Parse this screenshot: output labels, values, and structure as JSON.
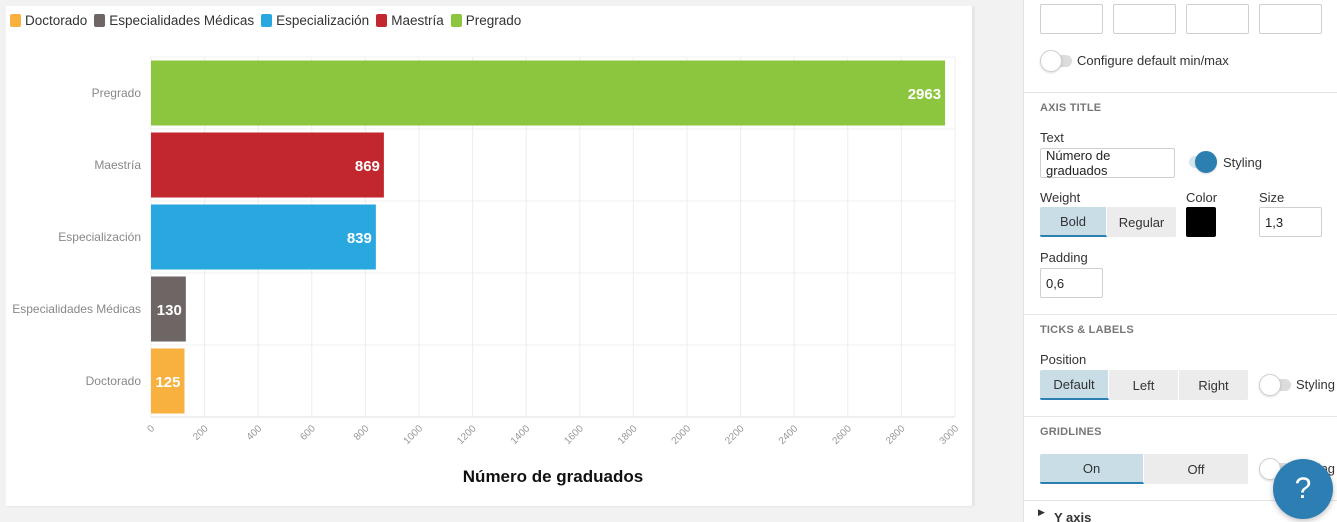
{
  "chart_data": {
    "type": "bar",
    "orientation": "horizontal",
    "categories": [
      "Pregrado",
      "Maestría",
      "Especialización",
      "Especialidades Médicas",
      "Doctorado"
    ],
    "values": [
      2963,
      869,
      839,
      130,
      125
    ],
    "colors": [
      "#8cc63f",
      "#c1272d",
      "#29a8e0",
      "#6e6565",
      "#f8b13e"
    ],
    "xlabel": "Número de graduados",
    "xlim": [
      0,
      3000
    ],
    "xticks": [
      0,
      200,
      400,
      600,
      800,
      1000,
      1200,
      1400,
      1600,
      1800,
      2000,
      2200,
      2400,
      2600,
      2800,
      3000
    ],
    "grid": true,
    "data_labels": true,
    "legend_position": "top-left",
    "legend": [
      {
        "name": "Doctorado",
        "color": "#f8b13e"
      },
      {
        "name": "Especialidades Médicas",
        "color": "#6e6565"
      },
      {
        "name": "Especialización",
        "color": "#29a8e0"
      },
      {
        "name": "Maestría",
        "color": "#c1272d"
      },
      {
        "name": "Pregrado",
        "color": "#8cc63f"
      }
    ]
  },
  "settings": {
    "minmax_toggle_label": "Configure default min/max",
    "axis_title": {
      "section_title": "AXIS TITLE",
      "text_label": "Text",
      "text_value": "Número de graduados",
      "styling_label": "Styling",
      "weight_label": "Weight",
      "weight_options": [
        "Bold",
        "Regular"
      ],
      "weight_selected": "Bold",
      "color_label": "Color",
      "color_value": "#000000",
      "size_label": "Size",
      "size_value": "1,3",
      "padding_label": "Padding",
      "padding_value": "0,6"
    },
    "ticks_labels": {
      "section_title": "TICKS & LABELS",
      "position_label": "Position",
      "position_options": [
        "Default",
        "Left",
        "Right"
      ],
      "position_selected": "Default",
      "styling_label": "Styling"
    },
    "gridlines": {
      "section_title": "GRIDLINES",
      "options": [
        "On",
        "Off"
      ],
      "selected": "On",
      "styling_label": "Styling"
    },
    "y_axis_label": "Y axis",
    "help_label": "?"
  }
}
